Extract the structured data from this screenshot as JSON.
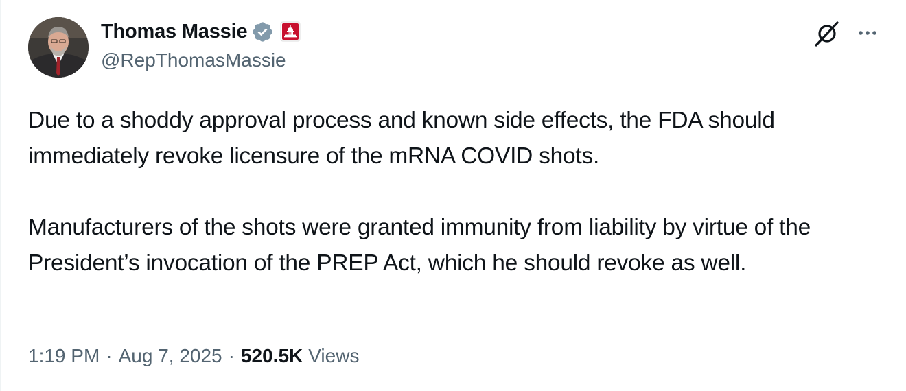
{
  "tweet": {
    "author": {
      "display_name": "Thomas Massie",
      "handle": "@RepThomasMassie",
      "verified_icon": "verified-badge-icon",
      "affiliation_icon": "capitol-building-icon"
    },
    "paragraphs": [
      "Due to a shoddy approval process and known side effects, the FDA should immediately revoke licensure of the mRNA COVID shots.",
      "Manufacturers of the shots were granted immunity from liability by virtue of the President’s invocation of the PREP Act, which he should revoke as well."
    ],
    "meta": {
      "time": "1:19 PM",
      "separator": "·",
      "date": "Aug 7, 2025",
      "views_count": "520.5K",
      "views_label": "Views"
    },
    "actions": {
      "grok_icon": "grok-icon",
      "more_icon": "more-options-icon"
    }
  },
  "colors": {
    "text_primary": "#0f1419",
    "text_secondary": "#536471",
    "verified_badge": "#829aab",
    "affiliation_badge": "#c8102e"
  }
}
